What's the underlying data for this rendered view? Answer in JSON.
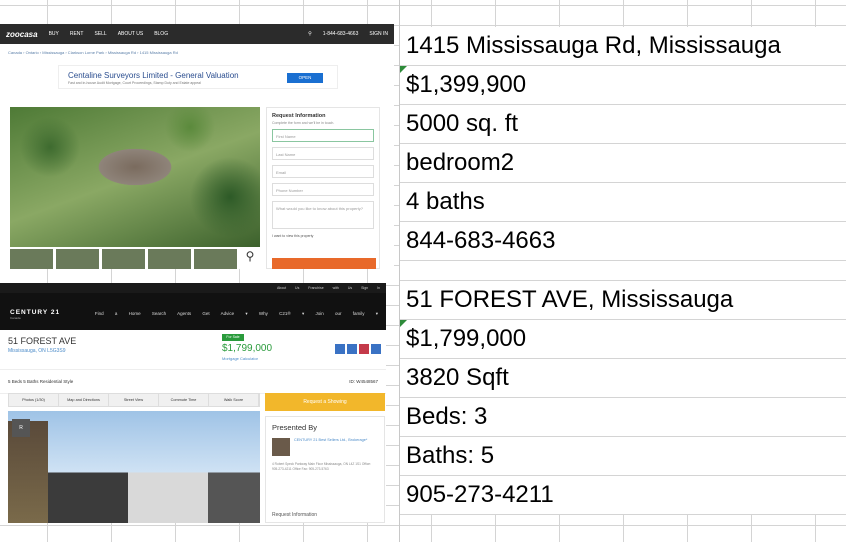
{
  "listing1": {
    "site": {
      "logo": "zoocasa",
      "nav": [
        "BUY",
        "RENT",
        "SELL",
        "ABOUT US",
        "BLOG"
      ],
      "phone": "1-844-683-4663",
      "signin": "SIGN IN",
      "breadcrumb": "Canada › Ontario › Mississauga › Clarkson Lorne Park › Mississauga Rd › 1415 Mississauga Rd",
      "ad_title": "Centaline Surveyors Limited - General Valuation",
      "ad_text": "Fast and in-house Audit Mortgage, Court Proceedings, Stamp Duty and Estate appeal",
      "ad_button": "OPEN",
      "form_title": "Request Information",
      "form_desc": "Complete the form and we'll be in touch.",
      "fields": [
        "First Name",
        "Last Name",
        "Email",
        "Phone Number",
        "What would you like to know about this property?"
      ],
      "checkbox": "I want to view this property"
    },
    "cells": [
      "1415 Mississauga Rd, Mississauga",
      "$1,399,900",
      "5000 sq. ft",
      "bedroom2",
      "4 baths",
      "844-683-4663"
    ]
  },
  "listing2": {
    "site": {
      "top_links": "About Us  Franchise with Us  Sign In",
      "logo": "CENTURY 21",
      "logo_sub": "Canada",
      "nav": "Find a Home   Search Agents   Get Advice ▾   Why C21® ▾   Join our family ▾",
      "address": "51 FOREST AVE",
      "city": "Mississauga, ON L5G3S9",
      "badge": "For Sale",
      "price": "$1,799,000",
      "calc": "Mortgage Calculator",
      "stats": "5 Beds   5 Baths   Residential Style",
      "id": "ID: W4548567",
      "tabs": [
        "Photos (1/30)",
        "Map and Directions",
        "Street View",
        "Commute Time",
        "Walk Score"
      ],
      "request": "Request a Showing",
      "presented": "Presented By",
      "agent": "CENTURY 21 Best Sellers Ltd., Brokerage*",
      "agent_addr": "4 Robert Speck Parkway Main Floor Mississauga, ON L4Z 1S1 Office: 905-273-4211 Office Fax: 905-273-5763",
      "req_info": "Request Information"
    },
    "cells": [
      "51 FOREST AVE, Mississauga",
      "$1,799,000",
      "3820 Sqft",
      "Beds: 3",
      "Baths: 5",
      "905-273-4211"
    ]
  }
}
